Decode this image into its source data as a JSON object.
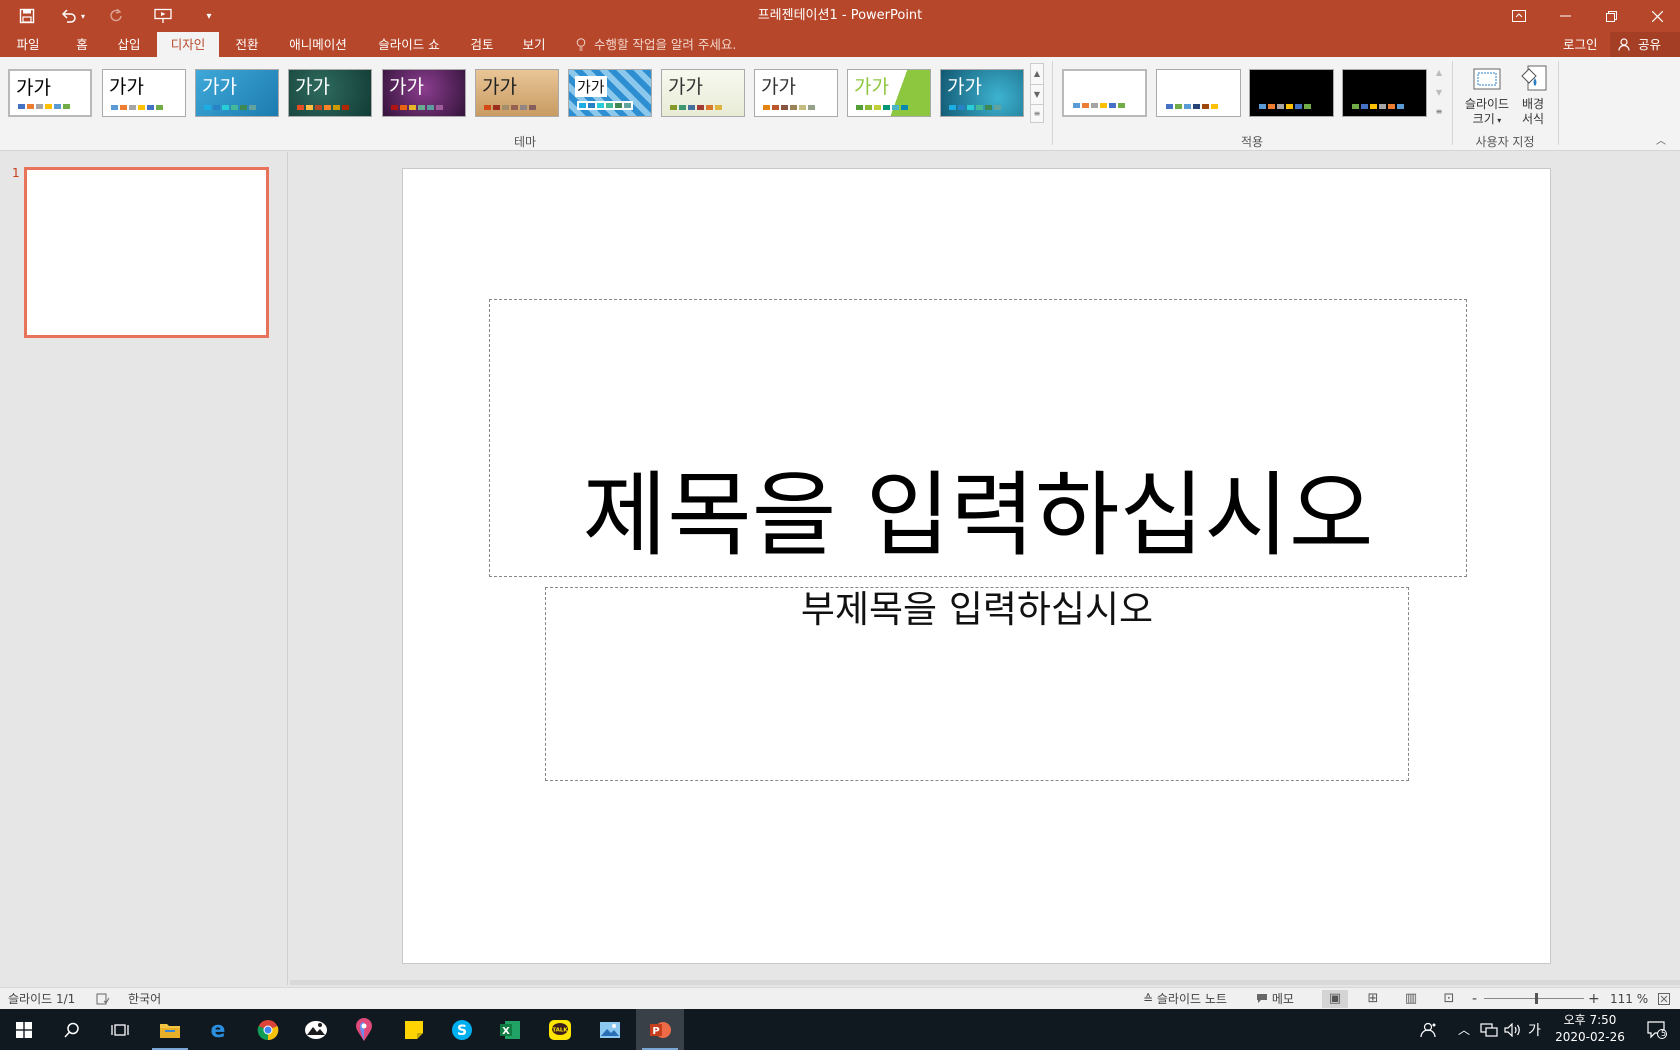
{
  "window": {
    "title": "프레젠테이션1 - PowerPoint"
  },
  "tabs": [
    {
      "label": "파일"
    },
    {
      "label": "홈"
    },
    {
      "label": "삽입"
    },
    {
      "label": "디자인"
    },
    {
      "label": "전환"
    },
    {
      "label": "애니메이션"
    },
    {
      "label": "슬라이드 쇼"
    },
    {
      "label": "검토"
    },
    {
      "label": "보기"
    }
  ],
  "active_tab": "디자인",
  "tell_me": "수행할 작업을 알려 주세요.",
  "account": {
    "login": "로그인",
    "share": "공유"
  },
  "ribbon": {
    "themes_group": "테마",
    "variants_group": "적용",
    "customize_group": "사용자 지정",
    "theme_sample": "가가",
    "slide_size": {
      "line1": "슬라이드",
      "line2": "크기"
    },
    "format_bg": {
      "line1": "배경",
      "line2": "서식"
    }
  },
  "slide_pane": {
    "number": "1"
  },
  "slide": {
    "title_placeholder": "제목을 입력하십시오",
    "subtitle_placeholder": "부제목을 입력하십시오"
  },
  "status": {
    "slide_count": "슬라이드 1/1",
    "language": "한국어",
    "notes": "슬라이드 노트",
    "comments": "메모",
    "zoom_minus": "-",
    "zoom_plus": "+",
    "zoom": "111 %"
  },
  "taskbar": {
    "time": "오후 7:50",
    "date": "2020-02-26",
    "ime": "가",
    "notif_count": "5"
  },
  "colors": {
    "accent": "#b7472a",
    "slide_selection": "#e8735a"
  }
}
